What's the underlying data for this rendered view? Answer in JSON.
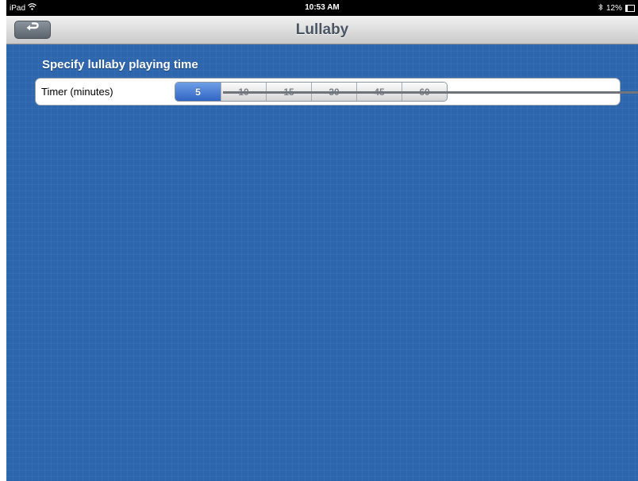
{
  "status_bar": {
    "device": "iPad",
    "wifi_icon": "wifi-icon",
    "time": "10:53 AM",
    "bluetooth_icon": "bluetooth-icon",
    "battery": "12%",
    "battery_icon": "battery-icon"
  },
  "nav": {
    "title": "Lullaby",
    "back_icon": "back-arrow-icon"
  },
  "section": {
    "header": "Specify lullaby playing time"
  },
  "timer": {
    "label": "Timer (minutes)",
    "options": [
      "5",
      "10",
      "15",
      "30",
      "45",
      "60"
    ],
    "selected": "5"
  },
  "colors": {
    "background": "#2e66ad",
    "selected_segment": "#3f74d2",
    "nav_title": "#4a5564"
  }
}
